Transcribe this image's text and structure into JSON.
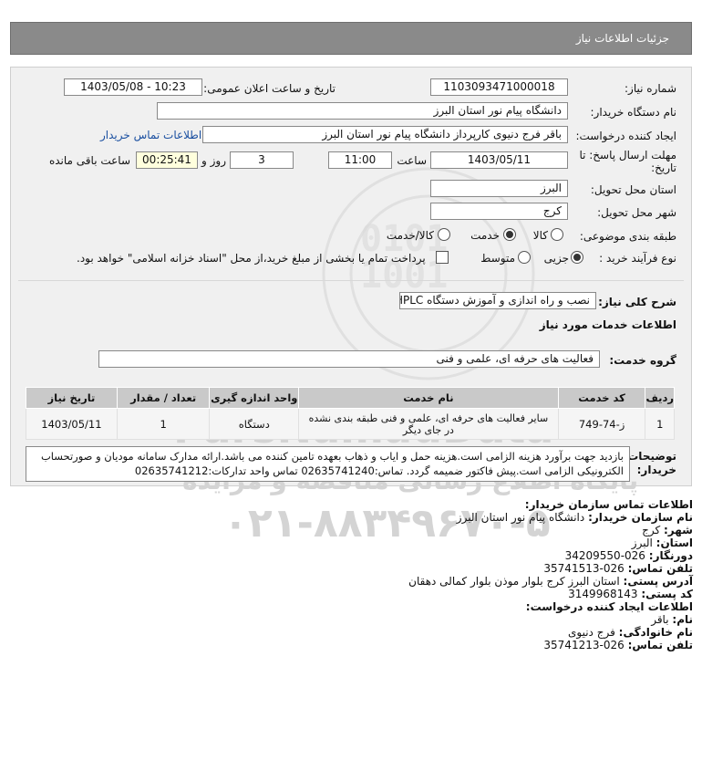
{
  "header": {
    "title": "جزئیات اطلاعات نیاز"
  },
  "form": {
    "need_number_label": "شماره نیاز:",
    "need_number": "1103093471000018",
    "announce_label": "تاریخ و ساعت اعلان عمومی:",
    "announce_value": "1403/05/08 - 10:23",
    "buyer_org_label": "نام دستگاه خریدار:",
    "buyer_org": "دانشگاه پیام نور استان البرز",
    "requester_label": "ایجاد کننده درخواست:",
    "requester": "باقر فرج دنیوی کارپرداز دانشگاه پیام نور استان البرز",
    "buyer_contact_link": "اطلاعات تماس خریدار",
    "deadline_label": "مهلت ارسال پاسخ: تا تاریخ:",
    "deadline_date": "1403/05/11",
    "time_label": "ساعت",
    "deadline_time": "11:00",
    "days": "3",
    "days_label": "روز و",
    "remaining_time": "00:25:41",
    "remaining_label": "ساعت باقی مانده",
    "province_label": "استان محل تحویل:",
    "province": "البرز",
    "city_label": "شهر محل تحویل:",
    "city": "کرج",
    "category_label": "طبقه بندی موضوعی:",
    "category_options": [
      "کالا",
      "خدمت",
      "کالا/خدمت"
    ],
    "category_selected": "خدمت",
    "process_label": "نوع فرآیند خرید :",
    "process_options": [
      "جزیی",
      "متوسط"
    ],
    "process_selected": "جزیی",
    "treasury_text": "پرداخت تمام یا بخشی از مبلغ خرید،از محل \"اسناد خزانه اسلامی\" خواهد بود."
  },
  "summary": {
    "label": "شرح کلی نیاز:",
    "value": "نصب و راه اندازی و آموزش دستگاه HPLC"
  },
  "services": {
    "section_title": "اطلاعات خدمات مورد نیاز",
    "group_label": "گروه خدمت:",
    "group_value": "فعالیت های حرفه ای، علمی و فنی",
    "columns": [
      "ردیف",
      "کد خدمت",
      "نام خدمت",
      "واحد اندازه گیری",
      "تعداد / مقدار",
      "تاریخ نیاز"
    ],
    "rows": [
      {
        "index": "1",
        "code": "ز-74-749",
        "name": "سایر فعالیت های حرفه ای، علمی و فنی طبقه بندی نشده در جای دیگر",
        "unit": "دستگاه",
        "qty": "1",
        "date": "1403/05/11"
      }
    ]
  },
  "buyer_notes": {
    "label": "توضیحات خریدار:",
    "text": "بازدید جهت برآورد هزینه الزامی است.هزینه حمل و ایاب و ذهاب بعهده تامین کننده می باشد.ارائه مدارک سامانه مودیان و صورتحساب الکترونیکی الزامی است.پیش فاکتور ضمیمه گردد. تماس:02635741240 تماس واحد تدارکات:02635741212"
  },
  "contact": {
    "title": "اطلاعات تماس سازمان خریدار:",
    "org_label": "نام سازمان خریدار:",
    "org": "دانشگاه پیام نور استان البرز",
    "city_label": "شهر:",
    "city": "کرج",
    "province_label": "استان:",
    "province": "البرز",
    "fax_label": "دورنگار:",
    "fax": "026-34209550",
    "phone_label": "تلفن تماس:",
    "phone": "026-35741513",
    "address_label": "آدرس پستی:",
    "address": "استان البرز کرج بلوار موذن بلوار کمالی دهقان",
    "postal_label": "کد پستی:",
    "postal": "3149968143",
    "creator_title": "اطلاعات ایجاد کننده درخواست:",
    "first_name_label": "نام:",
    "first_name": "باقر",
    "last_name_label": "نام خانوادگی:",
    "last_name": "فرج دنیوی",
    "creator_phone_label": "تلفن تماس:",
    "creator_phone": "026-35741213"
  },
  "watermark": {
    "brand": "ParsNamadData",
    "tagline": "پایگاه اطلاع رسانی مناقصه و مزایده",
    "phone": "۰۲۱-۸۸۳۴۹۶۷۰-۵",
    "color": "#c7c7c7"
  }
}
